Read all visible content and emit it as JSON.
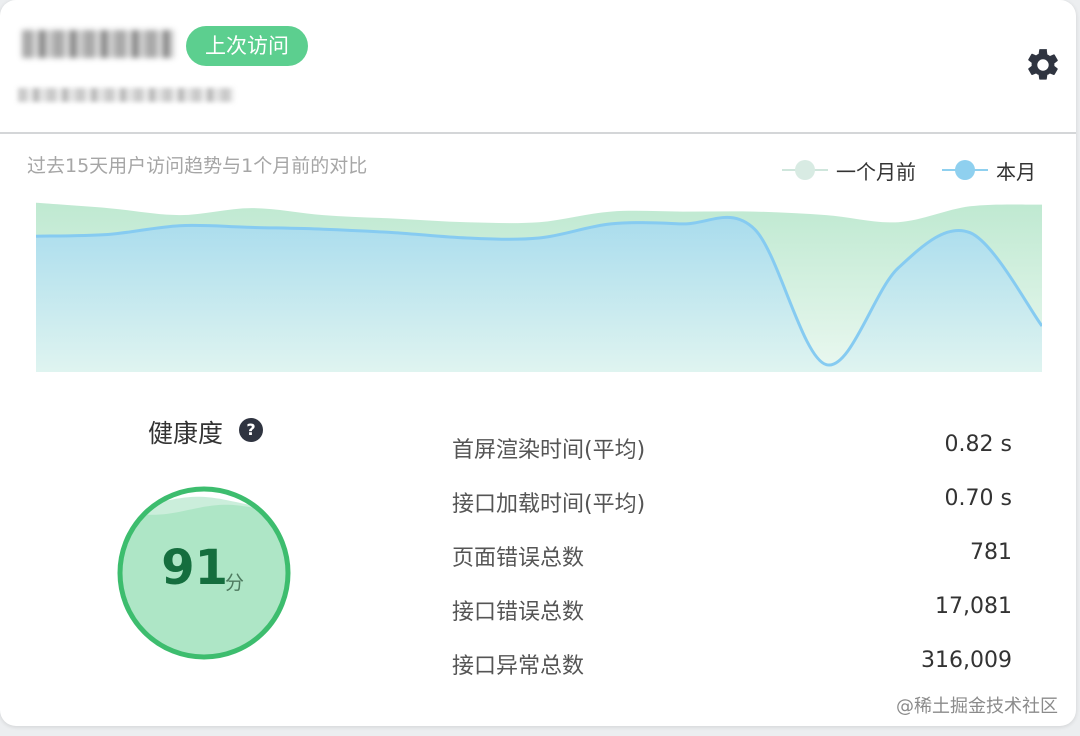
{
  "header": {
    "badge_label": "上次访问",
    "settings_icon": "gear-icon"
  },
  "trend": {
    "caption": "过去15天用户访问趋势与1个月前的对比",
    "legend": [
      {
        "name": "一个月前",
        "color": "#cfeadf"
      },
      {
        "name": "本月",
        "color": "#8fd0ef"
      }
    ]
  },
  "chart_data": {
    "type": "area",
    "title": "过去15天用户访问趋势与1个月前的对比",
    "x": [
      1,
      2,
      3,
      4,
      5,
      6,
      7,
      8,
      9,
      10,
      11,
      12,
      13,
      14,
      15
    ],
    "ylim": [
      0,
      100
    ],
    "grid": false,
    "legend_position": "top-right",
    "series": [
      {
        "name": "一个月前",
        "color": "#c4eed5",
        "values": [
          95,
          92,
          88,
          92,
          88,
          86,
          84,
          84,
          90,
          90,
          90,
          88,
          84,
          93,
          94
        ]
      },
      {
        "name": "本月",
        "color": "#86cbf1",
        "values": [
          76,
          77,
          82,
          81,
          80,
          78,
          75,
          75,
          83,
          83,
          80,
          3,
          58,
          78,
          25
        ]
      }
    ]
  },
  "health": {
    "title": "健康度",
    "help_icon": "question-icon",
    "score": "91",
    "unit": "分",
    "score_fraction": 0.91,
    "ring_color": "#3dbd6e"
  },
  "metrics": [
    {
      "label": "首屏渲染时间(平均)",
      "value": "0.82 s"
    },
    {
      "label": "接口加载时间(平均)",
      "value": "0.70 s"
    },
    {
      "label": "页面错误总数",
      "value": "781"
    },
    {
      "label": "接口错误总数",
      "value": "17,081"
    },
    {
      "label": "接口异常总数",
      "value": "316,009"
    }
  ],
  "watermark": "@稀土掘金技术社区"
}
